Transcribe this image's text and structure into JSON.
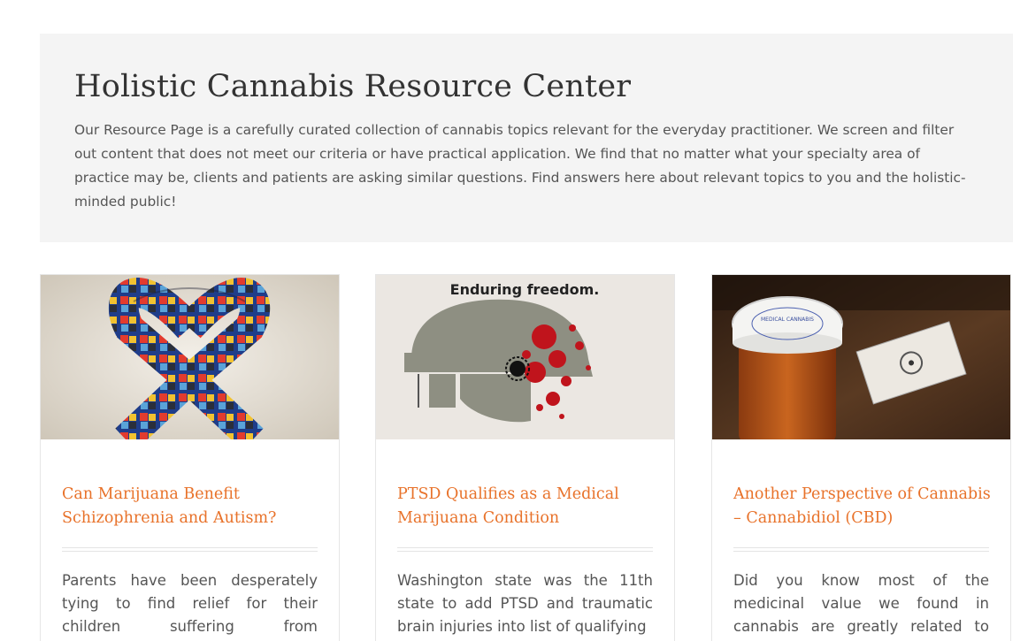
{
  "hero": {
    "title": "Holistic Cannabis Resource Center",
    "description": "Our Resource Page is a carefully curated collection of cannabis topics relevant for the everyday practitioner. We screen and filter out content that does not meet our criteria or have practical application. We find that no matter what your specialty area of practice may be, clients and patients are asking similar questions. Find answers here about relevant topics to you and the holistic-minded public!"
  },
  "cards": [
    {
      "image": "autism-awareness-ribbon",
      "title": "Can Marijuana Benefit Schizophrenia and Autism?",
      "excerpt": "Parents have been desperately tying to find relief for their children suffering from neurological disorders"
    },
    {
      "image": "soldier-helmet-poster",
      "image_caption": "Enduring freedom.",
      "title": "PTSD Qualifies as a Medical Marijuana Condition",
      "excerpt": "Washington state was the 11th state to add PTSD and traumatic brain injuries into list of qualifying"
    },
    {
      "image": "medical-cannabis-pill-bottle",
      "image_lid_text": "MEDICAL CANNABIS",
      "title": "Another Perspective of Cannabis – Cannabidiol (CBD)",
      "excerpt": "Did you know most of the medicinal value we found in cannabis are greatly related to cannabidiol or"
    }
  ],
  "colors": {
    "accent": "#e8722a",
    "hero_bg": "#f4f4f4"
  }
}
